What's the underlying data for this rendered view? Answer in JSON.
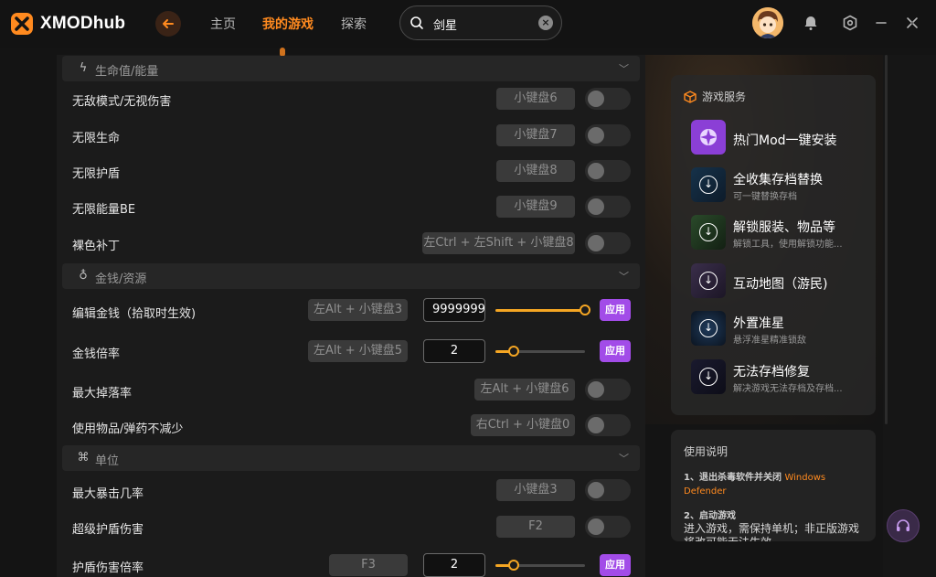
{
  "app": {
    "brand": "XMODhub"
  },
  "nav": {
    "home": "主页",
    "my_games": "我的游戏",
    "explore": "探索"
  },
  "search": {
    "value": "剑星",
    "clear": "×"
  },
  "sections": [
    {
      "title": "生命值/能量",
      "icon": "lightning-icon"
    },
    {
      "title": "金钱/资源",
      "icon": "money-bag-icon"
    },
    {
      "title": "单位",
      "icon": "unit-icon"
    }
  ],
  "cheats": [
    {
      "label": "无敌模式/无视伤害",
      "key": "小键盘6",
      "enabled": false
    },
    {
      "label": "无限生命",
      "key": "小键盘7",
      "enabled": false
    },
    {
      "label": "无限护盾",
      "key": "小键盘8",
      "enabled": false
    },
    {
      "label": "无限能量BE",
      "key": "小键盘9",
      "enabled": false
    },
    {
      "label": "裸色补丁",
      "key": "左Ctrl + 左Shift + 小键盘8",
      "enabled": false
    },
    {
      "label": "编辑金钱（拾取时生效)",
      "key": "左Alt + 小键盘3",
      "input": "9999999",
      "slider": 1.0,
      "apply": "应用"
    },
    {
      "label": "金钱倍率",
      "key": "左Alt + 小键盘5",
      "input": "2",
      "slider": 0.2,
      "apply": "应用"
    },
    {
      "label": "最大掉落率",
      "key": "左Alt + 小键盘6",
      "enabled": false
    },
    {
      "label": "使用物品/弹药不减少",
      "key": "右Ctrl + 小键盘0",
      "enabled": false
    },
    {
      "label": "最大暴击几率",
      "key": "小键盘3",
      "enabled": false
    },
    {
      "label": "超级护盾伤害",
      "key": "F2",
      "enabled": false
    },
    {
      "label": "护盾伤害倍率",
      "key": "F3",
      "input": "2",
      "slider": 0.2,
      "apply": "应用"
    }
  ],
  "services": {
    "title": "游戏服务",
    "items": [
      {
        "title": "热门Mod一键安装",
        "subtitle": "",
        "icon": "mod-install-icon"
      },
      {
        "title": "全收集存档替换",
        "subtitle": "可一键替换存档",
        "icon": "download-icon"
      },
      {
        "title": "解锁服装、物品等",
        "subtitle": "解锁工具，使用解锁功能...",
        "icon": "download-icon"
      },
      {
        "title": "互动地图（游民)",
        "subtitle": "",
        "icon": "download-icon"
      },
      {
        "title": "外置准星",
        "subtitle": "悬浮准星精准锁敌",
        "icon": "download-icon"
      },
      {
        "title": "无法存档修复",
        "subtitle": "解决游戏无法存档及存档...",
        "icon": "download-icon"
      }
    ]
  },
  "guide": {
    "title": "使用说明",
    "step1_prefix": "1、退出杀毒软件并关闭 ",
    "step1_highlight": "Windows Defender",
    "step2_title": "2、启动游戏",
    "step2_text": "进入游戏，需保持单机；非正版游戏将改可能无法生效"
  },
  "colors": {
    "accent": "#ff8a1f",
    "apply": "#a24ce8",
    "slider": "#f5a623"
  }
}
